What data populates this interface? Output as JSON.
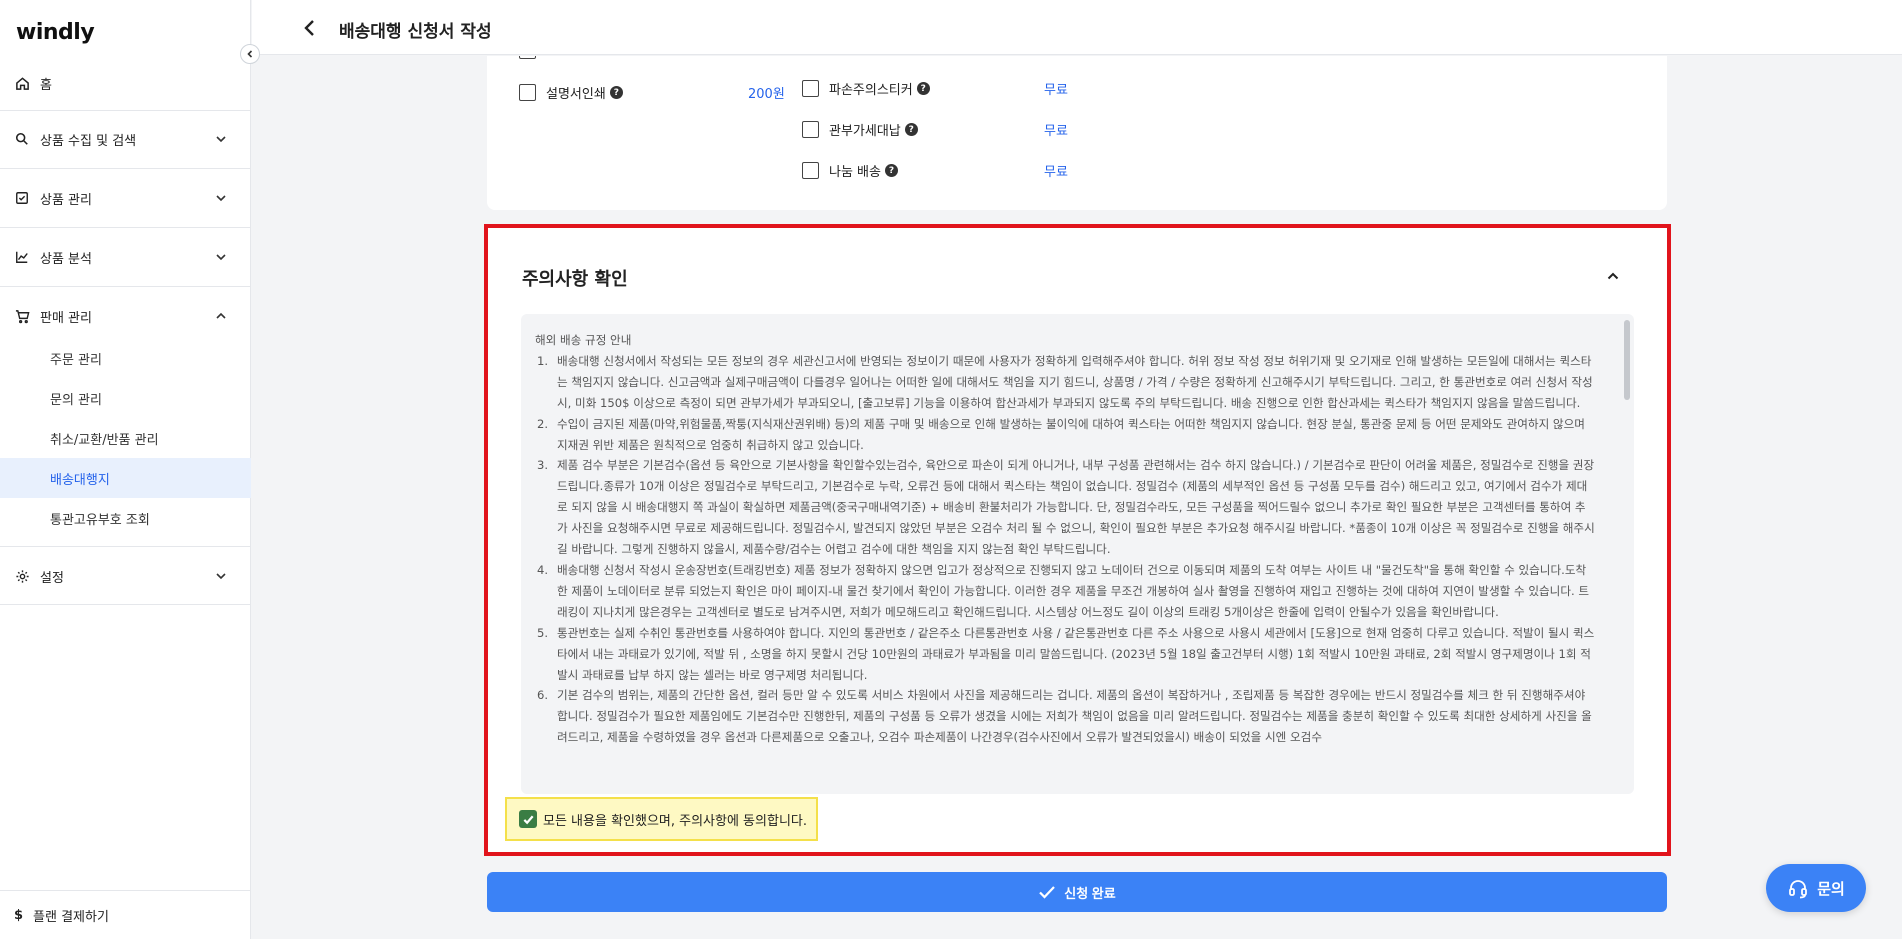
{
  "app": {
    "logo": "windly"
  },
  "sidebar": {
    "home": "홈",
    "menus": [
      {
        "label": "상품 수집 및 검색"
      },
      {
        "label": "상품 관리"
      },
      {
        "label": "상품 분석"
      },
      {
        "label": "판매 관리"
      }
    ],
    "sales_items": [
      {
        "label": "주문 관리"
      },
      {
        "label": "문의 관리"
      },
      {
        "label": "취소/교환/반품 관리"
      },
      {
        "label": "배송대행지"
      },
      {
        "label": "통관고유부호 조회"
      }
    ],
    "settings": "설정",
    "plan": "플랜 결제하기",
    "plan_symbol": "$"
  },
  "header": {
    "title": "배송대행 신청서 작성"
  },
  "options": {
    "left": [
      {
        "label": "설명서인쇄",
        "price": "200원"
      }
    ],
    "right": [
      {
        "label": "파손주의스티커",
        "price": "무료"
      },
      {
        "label": "관부가세대납",
        "price": "무료"
      },
      {
        "label": "나눔 배송",
        "price": "무료"
      }
    ],
    "help_mark": "?"
  },
  "notice": {
    "title": "주의사항 확인",
    "heading": "해외 배송 규정 안내",
    "items": [
      {
        "num": "1.",
        "text": "배송대행 신청서에서 작성되는 모든 정보의 경우 세관신고서에 반영되는 정보이기 때문에 사용자가 정확하게 입력해주셔야 합니다. 허위 정보 작성 정보 허위기재 및 오기재로 인해 발생하는 모든일에 대해서는 퀵스타는 책임지지 않습니다. 신고금액과 실제구매금액이 다를경우 일어나는 어떠한 일에 대해서도 책임을 지기 힘드니, 상품명 / 가격 / 수량은 정확하게 신고해주시기 부탁드립니다. 그리고, 한 통관번호로 여러 신청서 작성 시, 미화 150$ 이상으로 측정이 되면 관부가세가 부과되오니, [출고보류] 기능을 이용하여 합산과세가 부과되지 않도록 주의 부탁드립니다. 배송 진행으로 인한 합산과세는 퀵스타가 책임지지 않음을 말씀드립니다."
      },
      {
        "num": "2.",
        "text": "수입이 금지된 제품(마약,위험물품,짝퉁(지식재산권위배) 등)의 제품 구매 및 배송으로 인해 발생하는 불이익에 대하여 퀵스타는 어떠한 책임지지 않습니다. 현장 분실, 통관중 문제 등 어떤 문제와도 관여하지 않으며 지재권 위반 제품은 원칙적으로 엄중히 취급하지 않고 있습니다."
      },
      {
        "num": "3.",
        "text": "제품 검수 부분은 기본검수(옵션 등 육안으로 기본사항을 확인할수있는검수, 육안으로 파손이 되게 아니거나, 내부 구성품 관련해서는 검수 하지 않습니다.) / 기본검수로 판단이 어려울 제품은, 정밀검수로 진행을 권장드립니다.종류가 10개 이상은 정밀검수로 부탁드리고, 기본검수로 누락, 오류건 등에 대해서 퀵스타는 책임이 없습니다. 정밀검수 (제품의 세부적인 옵션 등 구성품 모두를 검수) 해드리고 있고, 여기에서 검수가 제대로 되지 않을 시 배송대행지 쪽 과실이 확실하면 제품금액(중국구매내역기준) + 배송비 환불처리가 가능합니다. 단, 정밀검수라도, 모든 구성품을 찍어드릴수 없으니 추가로 확인 필요한 부분은 고객센터를 통하여 추가 사진을 요청해주시면 무료로 제공해드립니다. 정밀검수시, 발견되지 않았던 부분은 오검수 처리 될 수 없으니, 확인이 필요한 부분은 추가요청 해주시길 바랍니다. *품종이 10개 이상은 꼭 정밀검수로 진행을 해주시길 바랍니다. 그렇게 진행하지 않을시, 제품수량/검수는 어렵고 검수에 대한 책임을 지지 않는점 확인 부탁드립니다."
      },
      {
        "num": "4.",
        "text": "배송대행 신청서 작성시 운송장번호(트래킹번호) 제품 정보가 정확하지 않으면 입고가 정상적으로 진행되지 않고 노데이터 건으로 이동되며 제품의 도착 여부는 사이트 내 \"물건도착\"을 통해 확인할 수 있습니다.도착한 제품이 노데이터로 분류 되었는지 확인은 마이 페이지-내 물건 찾기에서 확인이 가능합니다. 이러한 경우 제품을 무조건 개봉하여 실사 촬영을 진행하여 재입고 진행하는 것에 대하여 지연이 발생할 수 있습니다. 트래킹이 지나치게 많은경우는 고객센터로 별도로 남겨주시면, 저희가 메모해드리고 확인해드립니다. 시스템상 어느정도 길이 이상의 트래킹 5개이상은 한줄에 입력이 안될수가 있음을 확인바랍니다."
      },
      {
        "num": "5.",
        "text": "통관번호는 실제 수취인 통관번호를 사용하여야 합니다. 지인의 통관번호 / 같은주소 다른통관번호 사용 / 같은통관번호 다른 주소 사용으로 사용시 세관에서 [도용]으로 현재 엄중히 다루고 있습니다. 적발이 될시 퀵스타에서 내는 과태료가 있기에, 적발 뒤 , 소명을 하지 못할시 건당 10만원의 과태료가 부과됨을 미리 말씀드립니다. (2023년 5월 18일 출고건부터 시행) 1회 적발시 10만원 과태료, 2회 적발시 영구제명이나 1회 적발시 과태료를 납부 하지 않는 셀러는 바로 영구제명 처리됩니다."
      },
      {
        "num": "6.",
        "text": "기본 검수의 범위는, 제품의 간단한 옵션, 컬러 등만 알 수 있도록 서비스 차원에서 사진을 제공해드리는 겁니다. 제품의 옵션이 복잡하거나 , 조립제품 등 복잡한 경우에는 반드시 정밀검수를 체크 한 뒤 진행해주셔야 합니다. 정밀검수가 필요한 제품임에도 기본검수만 진행한뒤, 제품의 구성품 등 오류가 생겼을 시에는 저희가 책임이 없음을 미리 알려드립니다. 정밀검수는 제품을 충분히 확인할 수 있도록 최대한 상세하게 사진을 올려드리고, 제품을 수령하였을 경우 옵션과 다른제품으로 오출고나, 오검수 파손제품이 나간경우(검수사진에서 오류가 발견되었을시) 배송이 되었을 시엔 오검수"
      }
    ],
    "agree_label": "모든 내용을 확인했으며, 주의사항에 동의합니다.",
    "agreed": true
  },
  "submit": {
    "label": "신청 완료"
  },
  "inquiry": {
    "label": "문의"
  },
  "colors": {
    "accent": "#3b82f6",
    "highlight_red": "#e1141c",
    "highlight_yellow": "#f4e04a",
    "check_green": "#3a7d44"
  }
}
